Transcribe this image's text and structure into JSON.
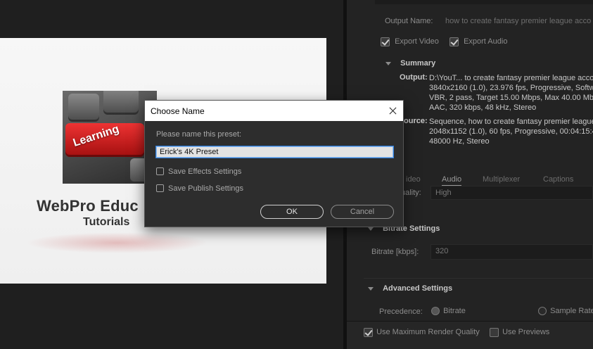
{
  "preview": {
    "image_text": "Learning",
    "logo_title": "WebPro Educ",
    "logo_subtitle": "Tutorials"
  },
  "export": {
    "output_name_label": "Output Name:",
    "output_name_value": "how to create fantasy premier league acco",
    "export_video_label": "Export Video",
    "export_audio_label": "Export Audio",
    "export_video_checked": true,
    "export_audio_checked": true
  },
  "summary": {
    "heading": "Summary",
    "output_label": "Output:",
    "output_lines": [
      "D:\\YouT... to create fantasy premier league acco",
      "3840x2160 (1.0), 23.976 fps, Progressive, Softwa",
      "VBR, 2 pass, Target 15.00 Mbps, Max 40.00 Mbp",
      "AAC, 320 kbps, 48 kHz, Stereo"
    ],
    "source_label": "ource:",
    "source_lines": [
      "Sequence, how to create fantasy premier league",
      "2048x1152 (1.0), 60 fps, Progressive, 00:04:15:4",
      "48000 Hz, Stereo"
    ]
  },
  "tabs": {
    "video": "ideo",
    "audio": "Audio",
    "multiplexer": "Multiplexer",
    "captions": "Captions"
  },
  "audio": {
    "quality_label": "uality:",
    "quality_value": "High",
    "bitrate_section": "Bitrate Settings",
    "bitrate_label": "Bitrate [kbps]:",
    "bitrate_value": "320",
    "advanced_section": "Advanced Settings",
    "precedence_label": "Precedence:",
    "precedence_bitrate": "Bitrate",
    "precedence_sample_rate": "Sample Rate"
  },
  "bottom": {
    "max_render_quality": "Use Maximum Render Quality",
    "use_previews": "Use Previews"
  },
  "dialog": {
    "title": "Choose Name",
    "prompt": "Please name this preset:",
    "preset_value": "Erick's 4K Preset",
    "save_effects": "Save Effects Settings",
    "save_publish": "Save Publish Settings",
    "ok": "OK",
    "cancel": "Cancel"
  },
  "colors": {
    "input_focus_border": "#2e7bd6",
    "dialog_bg": "#2d2d2d",
    "panel_bg": "#232323"
  }
}
